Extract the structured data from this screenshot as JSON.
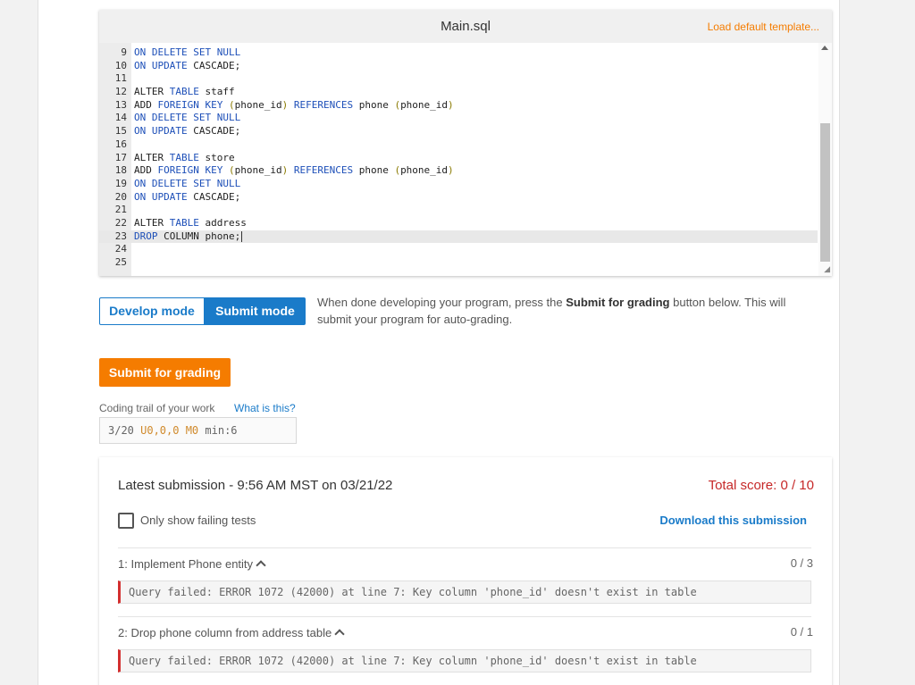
{
  "editor": {
    "title": "Main.sql",
    "load_template": "Load default template...",
    "lines": [
      {
        "n": "9",
        "tokens": [
          [
            "kw",
            "ON DELETE SET NULL"
          ]
        ]
      },
      {
        "n": "10",
        "tokens": [
          [
            "kw",
            "ON UPDATE"
          ],
          [
            "t",
            " CASCADE;"
          ]
        ]
      },
      {
        "n": "11",
        "tokens": []
      },
      {
        "n": "12",
        "tokens": [
          [
            "t",
            "ALTER "
          ],
          [
            "kw",
            "TABLE"
          ],
          [
            "t",
            " staff"
          ]
        ]
      },
      {
        "n": "13",
        "tokens": [
          [
            "t",
            "ADD "
          ],
          [
            "kw",
            "FOREIGN KEY"
          ],
          [
            "t",
            " "
          ],
          [
            "paren",
            "("
          ],
          [
            "t",
            "phone_id"
          ],
          [
            "paren",
            ")"
          ],
          [
            "t",
            " "
          ],
          [
            "kw",
            "REFERENCES"
          ],
          [
            "t",
            " phone "
          ],
          [
            "paren",
            "("
          ],
          [
            "t",
            "phone_id"
          ],
          [
            "paren",
            ")"
          ]
        ]
      },
      {
        "n": "14",
        "tokens": [
          [
            "kw",
            "ON DELETE SET NULL"
          ]
        ]
      },
      {
        "n": "15",
        "tokens": [
          [
            "kw",
            "ON UPDATE"
          ],
          [
            "t",
            " CASCADE;"
          ]
        ]
      },
      {
        "n": "16",
        "tokens": []
      },
      {
        "n": "17",
        "tokens": [
          [
            "t",
            "ALTER "
          ],
          [
            "kw",
            "TABLE"
          ],
          [
            "t",
            " store"
          ]
        ]
      },
      {
        "n": "18",
        "tokens": [
          [
            "t",
            "ADD "
          ],
          [
            "kw",
            "FOREIGN KEY"
          ],
          [
            "t",
            " "
          ],
          [
            "paren",
            "("
          ],
          [
            "t",
            "phone_id"
          ],
          [
            "paren",
            ")"
          ],
          [
            "t",
            " "
          ],
          [
            "kw",
            "REFERENCES"
          ],
          [
            "t",
            " phone "
          ],
          [
            "paren",
            "("
          ],
          [
            "t",
            "phone_id"
          ],
          [
            "paren",
            ")"
          ]
        ]
      },
      {
        "n": "19",
        "tokens": [
          [
            "kw",
            "ON DELETE SET NULL"
          ]
        ]
      },
      {
        "n": "20",
        "tokens": [
          [
            "kw",
            "ON UPDATE"
          ],
          [
            "t",
            " CASCADE;"
          ]
        ]
      },
      {
        "n": "21",
        "tokens": []
      },
      {
        "n": "22",
        "tokens": [
          [
            "t",
            "ALTER "
          ],
          [
            "kw",
            "TABLE"
          ],
          [
            "t",
            " address"
          ]
        ]
      },
      {
        "n": "23",
        "tokens": [
          [
            "kw",
            "DROP"
          ],
          [
            "t",
            " COLUMN phone;"
          ]
        ],
        "active": true
      },
      {
        "n": "24",
        "tokens": []
      },
      {
        "n": "25",
        "tokens": []
      }
    ]
  },
  "modes": {
    "develop": "Develop mode",
    "submit": "Submit mode",
    "active": "submit",
    "desc_before": "When done developing your program, press the ",
    "desc_bold": "Submit for grading",
    "desc_after": " button below. This will submit your program for auto-grading."
  },
  "submit_button": "Submit for grading",
  "trail": {
    "label": "Coding trail of your work",
    "help": "What is this?",
    "prefix": "3/20 ",
    "value_u": "U0,0,0",
    "value_m": " M0",
    "suffix": " min:6"
  },
  "submission": {
    "title": "Latest submission - 9:56 AM MST on 03/21/22",
    "total_score": "Total score: 0 / 10",
    "filter_label": "Only show failing tests",
    "filter_checked": false,
    "download": "Download this submission",
    "tests": [
      {
        "name": "1: Implement Phone entity",
        "score": "0 / 3",
        "error": "Query failed: ERROR 1072 (42000) at line 7: Key column 'phone_id' doesn't exist in table"
      },
      {
        "name": "2: Drop phone column from address table",
        "score": "0 / 1",
        "error": "Query failed: ERROR 1072 (42000) at line 7: Key column 'phone_id' doesn't exist in table"
      }
    ]
  },
  "colors": {
    "accent_blue": "#1a7bc9",
    "accent_orange": "#f57c00",
    "error_red": "#c62828",
    "keyword": "#1d4fb8"
  }
}
